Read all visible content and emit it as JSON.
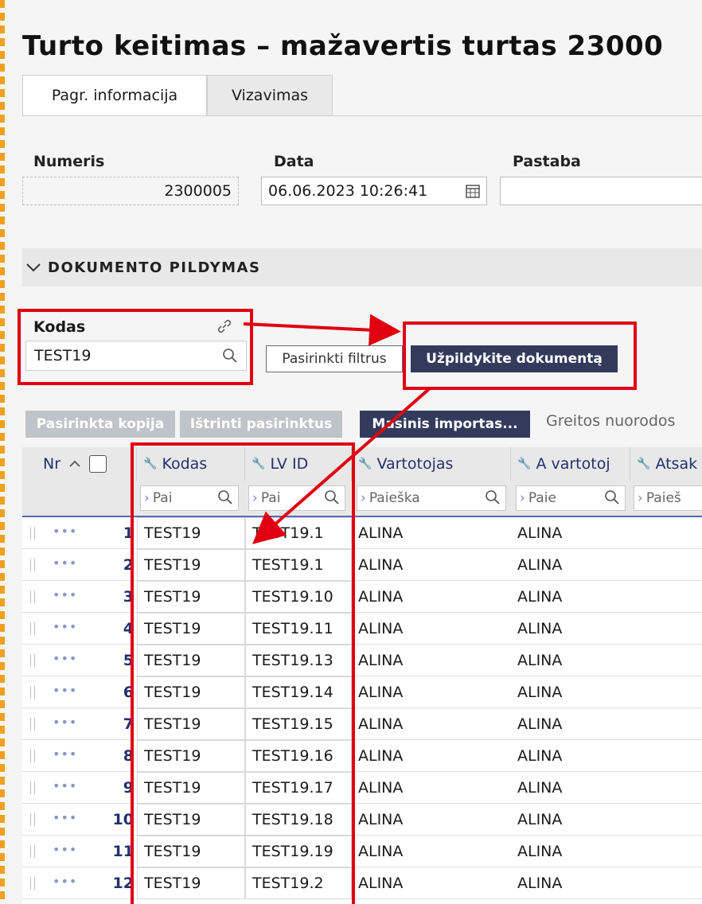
{
  "title": "Turto keitimas – mažavertis turtas 23000",
  "tabs": [
    {
      "label": "Pagr. informacija"
    },
    {
      "label": "Vizavimas"
    }
  ],
  "fields": {
    "numeris_label": "Numeris",
    "numeris_value": "2300005",
    "data_label": "Data",
    "data_value": "06.06.2023 10:26:41",
    "pastaba_label": "Pastaba",
    "pastaba_value": ""
  },
  "section": {
    "title": "DOKUMENTO PILDYMAS"
  },
  "kodas": {
    "label": "Kodas",
    "value": "TEST19"
  },
  "buttons": {
    "filters": "Pasirinkti filtrus",
    "fill": "Užpildykite dokumentą",
    "copy": "Pasirinkta kopija",
    "delete": "Ištrinti pasirinktus",
    "import": "Masinis importas...",
    "quick_links": "Greitos nuorodos"
  },
  "table": {
    "headers": {
      "nr": "Nr",
      "kodas": "Kodas",
      "lvid": "LV ID",
      "vartotojas": "Vartotojas",
      "avartotojas": "A vartotoj",
      "atsak": "Atsak"
    },
    "search": {
      "kodas": "Pai",
      "lvid": "Pai",
      "vartotojas": "Paieška",
      "avartotojas": "Paie",
      "atsak": "Paieš"
    },
    "rows": [
      {
        "nr": "1",
        "kodas": "TEST19",
        "lvid": "TEST19.1",
        "vartotojas": "ALINA",
        "avartotojas": "ALINA"
      },
      {
        "nr": "2",
        "kodas": "TEST19",
        "lvid": "TEST19.1",
        "vartotojas": "ALINA",
        "avartotojas": "ALINA"
      },
      {
        "nr": "3",
        "kodas": "TEST19",
        "lvid": "TEST19.10",
        "vartotojas": "ALINA",
        "avartotojas": "ALINA"
      },
      {
        "nr": "4",
        "kodas": "TEST19",
        "lvid": "TEST19.11",
        "vartotojas": "ALINA",
        "avartotojas": "ALINA"
      },
      {
        "nr": "5",
        "kodas": "TEST19",
        "lvid": "TEST19.13",
        "vartotojas": "ALINA",
        "avartotojas": "ALINA"
      },
      {
        "nr": "6",
        "kodas": "TEST19",
        "lvid": "TEST19.14",
        "vartotojas": "ALINA",
        "avartotojas": "ALINA"
      },
      {
        "nr": "7",
        "kodas": "TEST19",
        "lvid": "TEST19.15",
        "vartotojas": "ALINA",
        "avartotojas": "ALINA"
      },
      {
        "nr": "8",
        "kodas": "TEST19",
        "lvid": "TEST19.16",
        "vartotojas": "ALINA",
        "avartotojas": "ALINA"
      },
      {
        "nr": "9",
        "kodas": "TEST19",
        "lvid": "TEST19.17",
        "vartotojas": "ALINA",
        "avartotojas": "ALINA"
      },
      {
        "nr": "10",
        "kodas": "TEST19",
        "lvid": "TEST19.18",
        "vartotojas": "ALINA",
        "avartotojas": "ALINA"
      },
      {
        "nr": "11",
        "kodas": "TEST19",
        "lvid": "TEST19.19",
        "vartotojas": "ALINA",
        "avartotojas": "ALINA"
      },
      {
        "nr": "12",
        "kodas": "TEST19",
        "lvid": "TEST19.2",
        "vartotojas": "ALINA",
        "avartotojas": "ALINA"
      }
    ]
  },
  "colors": {
    "accent": "#343a5c",
    "highlight": "#e00010",
    "link": "#23306e"
  }
}
